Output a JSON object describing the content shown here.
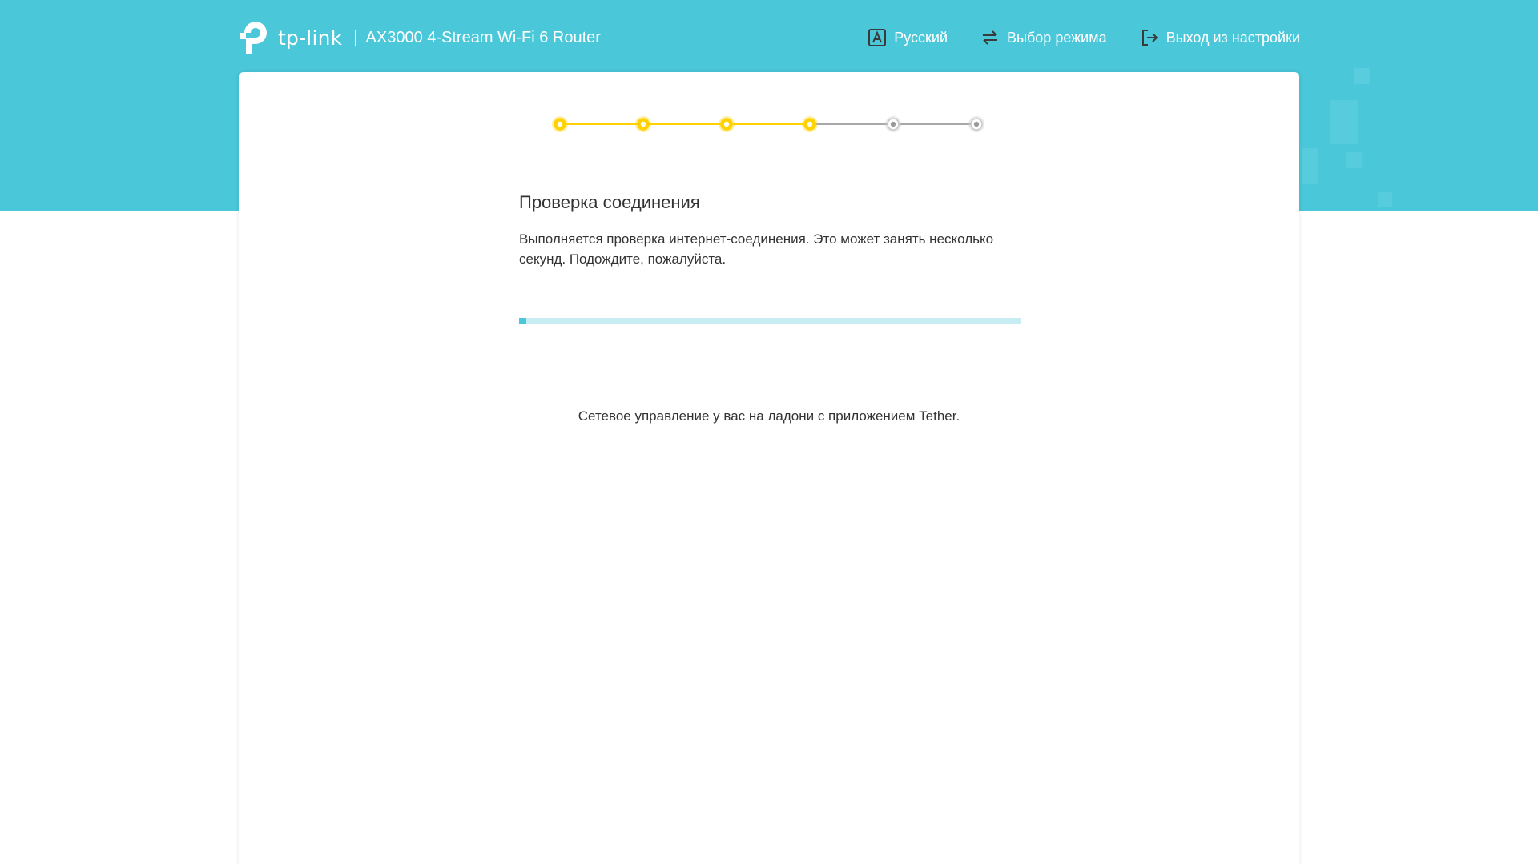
{
  "header": {
    "brand_name": "tp-link",
    "separator": "|",
    "model": "AX3000 4-Stream Wi-Fi 6 Router",
    "nav": [
      {
        "label": "Русский",
        "icon": "language-icon"
      },
      {
        "label": "Выбор режима",
        "icon": "mode-switch-icon"
      },
      {
        "label": "Выход из настройки",
        "icon": "exit-icon"
      }
    ]
  },
  "stepper": {
    "total_steps": 6,
    "completed_steps": 4
  },
  "main": {
    "title": "Проверка соединения",
    "description": "Выполняется проверка интернет-соединения. Это может занять несколько секунд. Подождите, пожалуйста.",
    "progress_percent": 1.5,
    "promo": "Сетевое управление у вас на ладони с приложением Tether."
  },
  "colors": {
    "accent": "#4ac7d9",
    "progress_track": "#c7ecf1",
    "step_active": "#ffd200",
    "step_inactive": "#c8c8c8"
  }
}
